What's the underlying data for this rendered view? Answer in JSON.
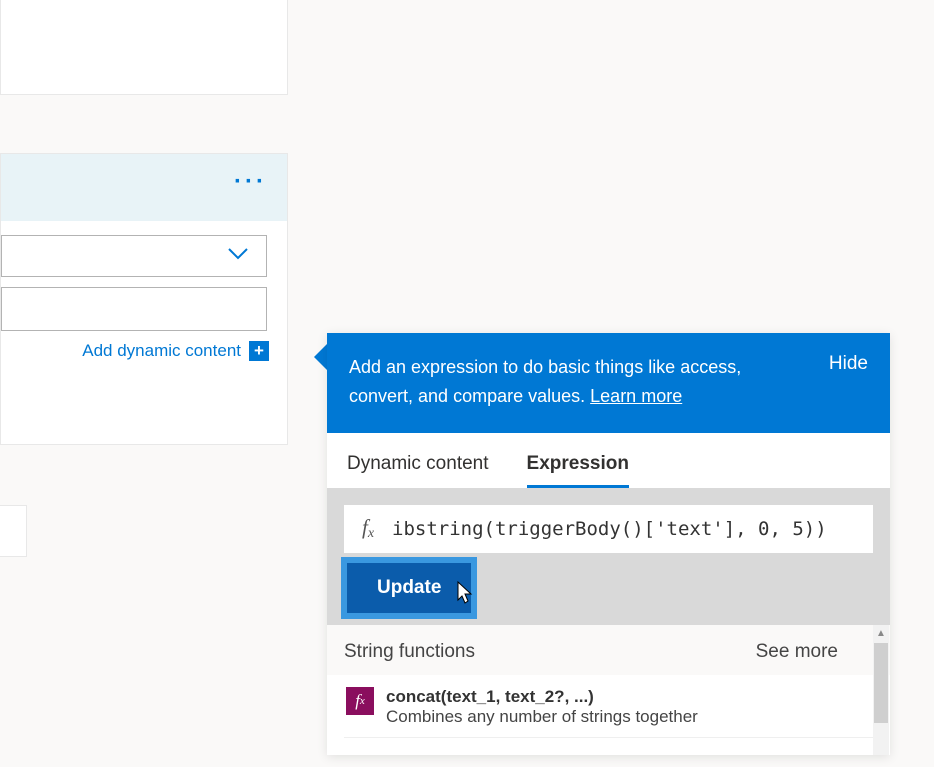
{
  "action": {
    "add_dynamic_label": "Add dynamic content"
  },
  "popover": {
    "header_text": "Add an expression to do basic things like access, convert, and compare values.",
    "learn_more": "Learn more",
    "hide": "Hide",
    "tabs": {
      "dynamic": "Dynamic content",
      "expression": "Expression"
    },
    "expression_value": "ibstring(triggerBody()['text'], 0, 5))",
    "update": "Update",
    "functions": {
      "section_title": "String functions",
      "see_more": "See more",
      "items": [
        {
          "name": "concat(text_1, text_2?, ...)",
          "desc": "Combines any number of strings together"
        }
      ]
    }
  }
}
